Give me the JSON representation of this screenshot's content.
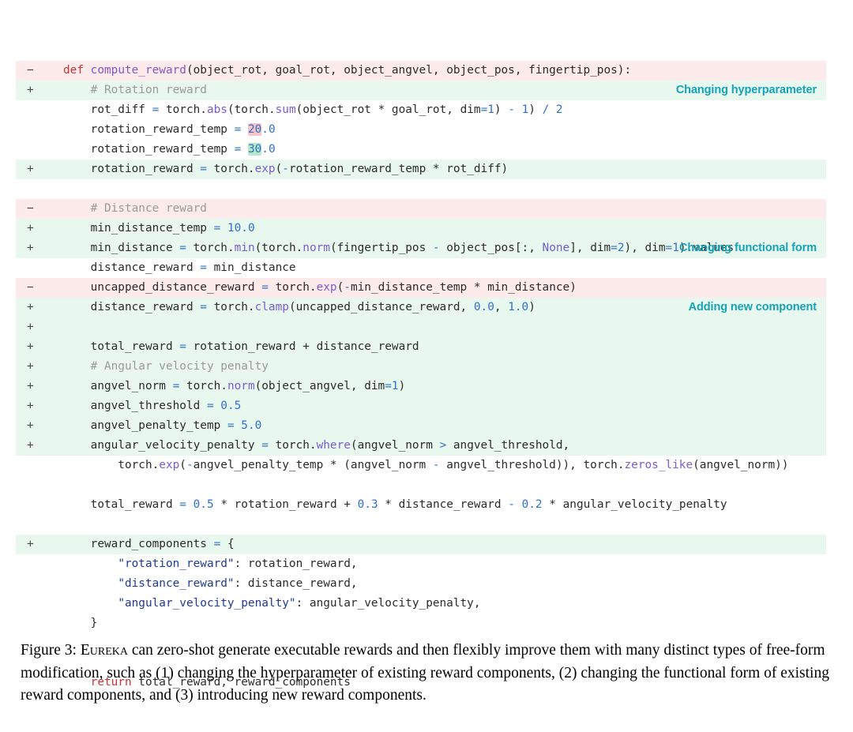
{
  "figure": {
    "caption_prefix": "Figure 3:",
    "caption_entity": "Eureka",
    "caption_rest": " can zero-shot generate executable rewards and then flexibly improve them with many distinct types of free-form modification, such as (1) changing the hyperparameter of existing reward components, (2) changing the functional form of existing reward components, and (3) introducing new reward components."
  },
  "colors": {
    "add_background": "#e8f8ee",
    "del_background": "#fdeaea",
    "annotation": "#14a3b8",
    "keyword": "#cc3333",
    "function": "#8457c7",
    "number": "#2f6fd0",
    "string": "#1f3a93",
    "comment": "#9a9a9a",
    "chip_del": "#f7c5c5",
    "chip_add": "#b6e8c5"
  },
  "annotations": {
    "hyperparameter": "Changing hyperparameter",
    "functional_form": "Changing functional form",
    "new_component": "Adding new component"
  },
  "markers": {
    "add": "+",
    "del": "−",
    "none": ""
  },
  "code": {
    "lines": [
      {
        "marker": "",
        "type": "ctx",
        "text": "def compute_reward(object_rot, goal_rot, object_angvel, object_pos, fingertip_pos):"
      },
      {
        "marker": "",
        "type": "ctx",
        "text": "    # Rotation reward"
      },
      {
        "marker": "",
        "type": "ctx",
        "text": "    rot_diff = torch.abs(torch.sum(object_rot * goal_rot, dim=1) - 1) / 2"
      },
      {
        "marker": "−",
        "type": "del",
        "text": "    rotation_reward_temp = 20.0"
      },
      {
        "marker": "+",
        "type": "add",
        "text": "    rotation_reward_temp = 30.0",
        "annotation": "Changing hyperparameter"
      },
      {
        "marker": "",
        "type": "ctx",
        "text": "    rotation_reward = torch.exp(-rotation_reward_temp * rot_diff)"
      },
      {
        "marker": "",
        "type": "ctx",
        "text": ""
      },
      {
        "marker": "",
        "type": "ctx",
        "text": "    # Distance reward"
      },
      {
        "marker": "+",
        "type": "add",
        "text": "    min_distance_temp = 10.0"
      },
      {
        "marker": "",
        "type": "ctx",
        "text": "    min_distance = torch.min(torch.norm(fingertip_pos - object_pos[:, None], dim=2), dim=1).values"
      },
      {
        "marker": "−",
        "type": "del",
        "text": "    distance_reward = min_distance"
      },
      {
        "marker": "+",
        "type": "add",
        "text": "    uncapped_distance_reward = torch.exp(-min_distance_temp * min_distance)"
      },
      {
        "marker": "+",
        "type": "add",
        "text": "    distance_reward = torch.clamp(uncapped_distance_reward, 0.0, 1.0)",
        "annotation": "Changing functional form"
      },
      {
        "marker": "",
        "type": "ctx",
        "text": ""
      },
      {
        "marker": "−",
        "type": "del",
        "text": "    total_reward = rotation_reward + distance_reward"
      },
      {
        "marker": "+",
        "type": "add",
        "text": "    # Angular velocity penalty",
        "annotation": "Adding new component"
      },
      {
        "marker": "+",
        "type": "add",
        "text": "    angvel_norm = torch.norm(object_angvel, dim=1)"
      },
      {
        "marker": "+",
        "type": "add",
        "text": "    angvel_threshold = 0.5"
      },
      {
        "marker": "+",
        "type": "add",
        "text": "    angvel_penalty_temp = 5.0"
      },
      {
        "marker": "+",
        "type": "add",
        "text": "    angular_velocity_penalty = torch.where(angvel_norm > angvel_threshold,"
      },
      {
        "marker": "+",
        "type": "add",
        "text": "        torch.exp(-angvel_penalty_temp * (angvel_norm - angvel_threshold)), torch.zeros_like(angvel_norm))"
      },
      {
        "marker": "+",
        "type": "add",
        "text": ""
      },
      {
        "marker": "+",
        "type": "add",
        "text": "    total_reward = 0.5 * rotation_reward + 0.3 * distance_reward - 0.2 * angular_velocity_penalty"
      },
      {
        "marker": "",
        "type": "ctx",
        "text": ""
      },
      {
        "marker": "",
        "type": "ctx",
        "text": "    reward_components = {"
      },
      {
        "marker": "",
        "type": "ctx",
        "text": "        \"rotation_reward\": rotation_reward,"
      },
      {
        "marker": "",
        "type": "ctx",
        "text": "        \"distance_reward\": distance_reward,"
      },
      {
        "marker": "+",
        "type": "add",
        "text": "        \"angular_velocity_penalty\": angular_velocity_penalty,"
      },
      {
        "marker": "",
        "type": "ctx",
        "text": "    }"
      },
      {
        "marker": "",
        "type": "ctx",
        "text": ""
      },
      {
        "marker": "",
        "type": "ctx",
        "text": "    return total_reward, reward_components"
      }
    ]
  }
}
